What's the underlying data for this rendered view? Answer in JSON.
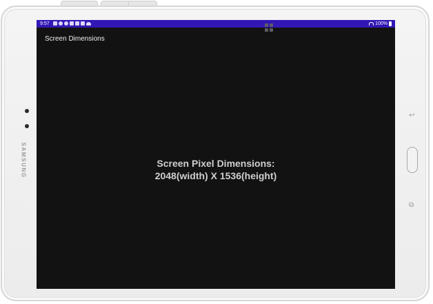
{
  "status_bar": {
    "time": "9:57",
    "battery": "100%",
    "notification_icons": [
      "messages-icon",
      "cloud-sync-icon",
      "settings-icon",
      "mail-icon",
      "mail-icon",
      "mail-icon",
      "weather-cloud-icon"
    ],
    "background_color": "#3317b5"
  },
  "app": {
    "title": "Screen Dimensions",
    "background_color": "#121212"
  },
  "content": {
    "line1": "Screen Pixel Dimensions:",
    "line2": "2048(width) X 1536(height)",
    "text_color": "#cfcfcf"
  },
  "device": {
    "brand": "SAMSUNG",
    "back_key_glyph": "↩",
    "recent_key_glyph": "⧉"
  }
}
